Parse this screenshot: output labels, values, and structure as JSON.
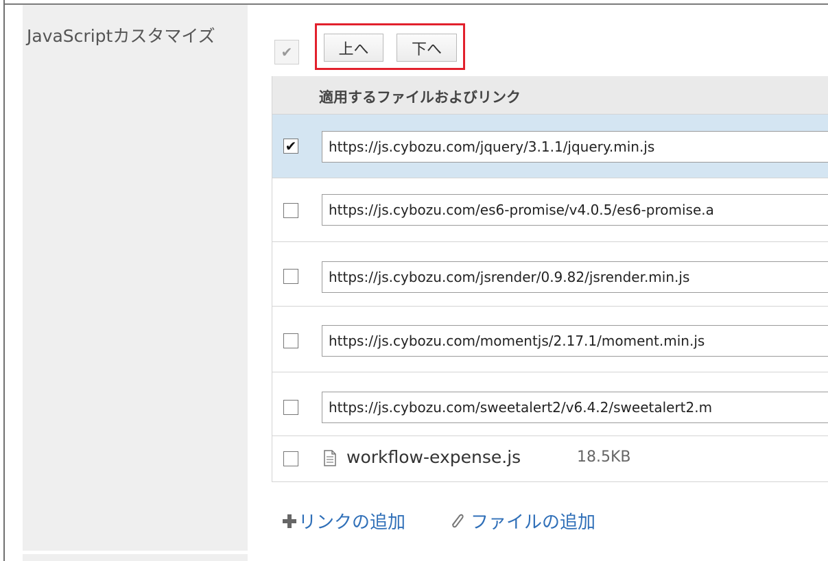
{
  "section": {
    "label": "JavaScriptカスタマイズ"
  },
  "toolbar": {
    "check_all_icon": "check-icon",
    "move_up_label": "上へ",
    "move_down_label": "下へ",
    "highlight_color": "#e2202c"
  },
  "table": {
    "header": "適用するファイルおよびリンク",
    "rows": [
      {
        "checked": true,
        "value": "https://js.cybozu.com/jquery/3.1.1/jquery.min.js"
      },
      {
        "checked": false,
        "value": "https://js.cybozu.com/es6-promise/v4.0.5/es6-promise.a"
      },
      {
        "checked": false,
        "value": "https://js.cybozu.com/jsrender/0.9.82/jsrender.min.js"
      },
      {
        "checked": false,
        "value": "https://js.cybozu.com/momentjs/2.17.1/moment.min.js"
      },
      {
        "checked": false,
        "value": "https://js.cybozu.com/sweetalert2/v6.4.2/sweetalert2.m"
      }
    ],
    "file": {
      "checked": false,
      "icon": "file-icon",
      "name": "workflow-expense.js",
      "size": "18.5KB"
    }
  },
  "actions": {
    "add_link_label": "リンクの追加",
    "add_file_label": "ファイルの追加",
    "link_color": "#2f6fb8"
  },
  "colors": {
    "selected_row": "#d4e5f2",
    "label_bg": "#efefef"
  }
}
